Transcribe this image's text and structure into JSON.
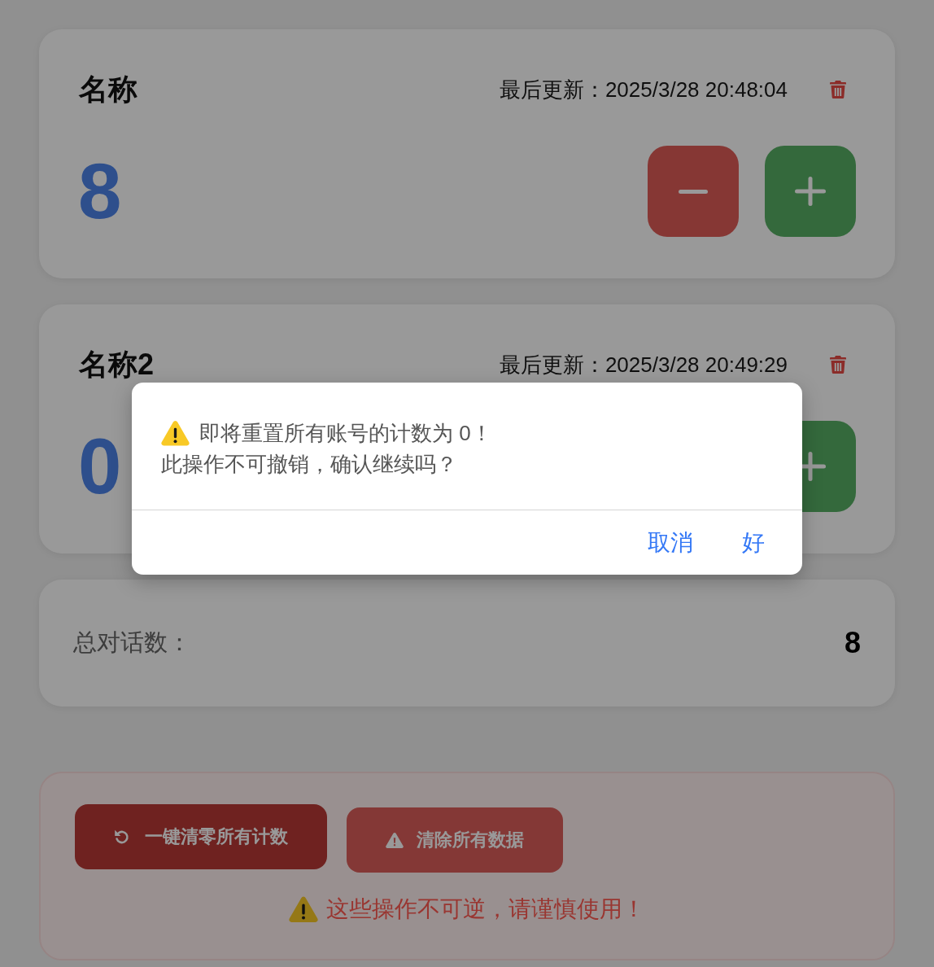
{
  "counters": [
    {
      "name": "名称",
      "last_updated": "最后更新：2025/3/28 20:48:04",
      "count": "8",
      "buttons": [
        {
          "kind": "decrement"
        },
        {
          "kind": "increment"
        }
      ]
    },
    {
      "name": "名称2",
      "last_updated": "最后更新：2025/3/28 20:49:29",
      "count": "0",
      "buttons": [
        {
          "kind": "increment"
        }
      ]
    }
  ],
  "summary": {
    "label": "总对话数：",
    "value": "8"
  },
  "danger_zone": {
    "buttons": [
      {
        "kind": "reset",
        "label": "一键清零所有计数"
      },
      {
        "kind": "clear",
        "label": "清除所有数据"
      }
    ],
    "warning": "这些操作不可逆，请谨慎使用！"
  },
  "dialog": {
    "message_lines": [
      "即将重置所有账号的计数为 0！",
      "此操作不可撤销，确认继续吗？"
    ],
    "buttons": [
      {
        "label": "取消"
      },
      {
        "label": "好"
      }
    ]
  }
}
